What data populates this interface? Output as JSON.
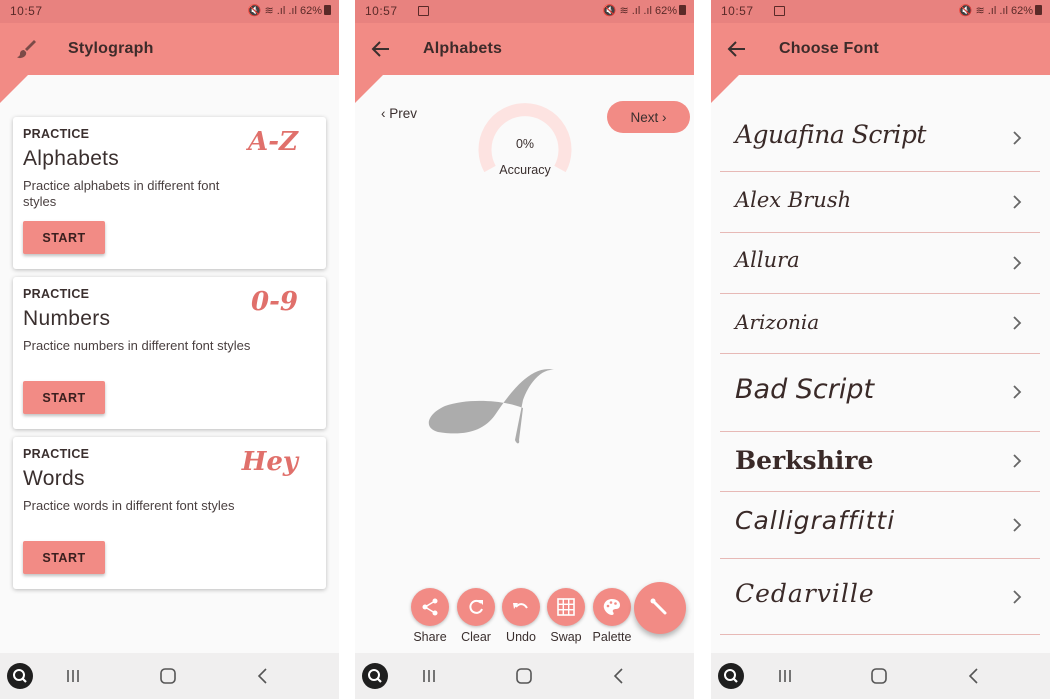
{
  "status": {
    "time": "10:57",
    "battery": "62%"
  },
  "screen1": {
    "title": "Stylograph",
    "cards": [
      {
        "kicker": "PRACTICE",
        "heading": "Alphabets",
        "description": "Practice alphabets in different font styles",
        "button": "START",
        "decoration": "A-Z"
      },
      {
        "kicker": "PRACTICE",
        "heading": "Numbers",
        "description": "Practice numbers in different font styles",
        "button": "START",
        "decoration": "0-9"
      },
      {
        "kicker": "PRACTICE",
        "heading": "Words",
        "description": "Practice words in different font styles",
        "button": "START",
        "decoration": "Hey"
      }
    ]
  },
  "screen2": {
    "title": "Alphabets",
    "prev": "Prev",
    "next": "Next",
    "accuracy_value": "0%",
    "accuracy_label": "Accuracy",
    "tools": [
      "Share",
      "Clear",
      "Undo",
      "Swap",
      "Palette"
    ]
  },
  "screen3": {
    "title": "Choose Font",
    "fonts": [
      "Aguafina Script",
      "Alex Brush",
      "Allura",
      "Arizonia",
      "Bad Script",
      "Berkshire",
      "Calligraffitti",
      "Cedarville"
    ]
  },
  "colors": {
    "appbar": "#f28b85",
    "statusbar": "#e8827f",
    "accent_text": "#e0706b",
    "gauge_track": "#fde3e1"
  }
}
